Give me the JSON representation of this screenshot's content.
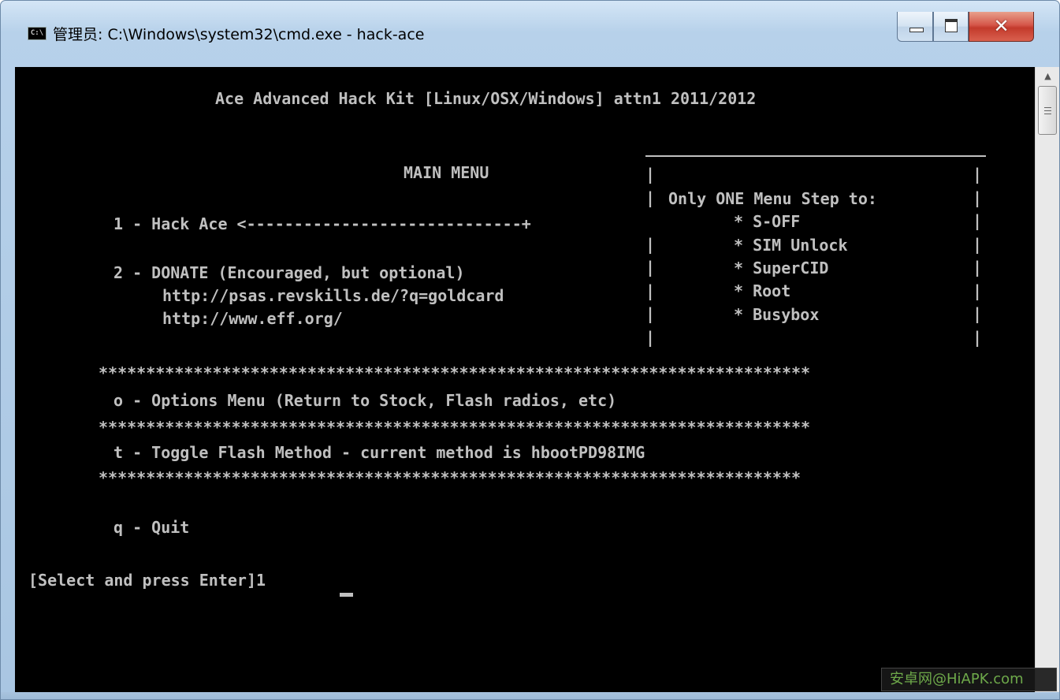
{
  "window": {
    "title": "管理员: C:\\Windows\\system32\\cmd.exe - hack-ace",
    "icon_label": "C:\\"
  },
  "console": {
    "lines": [
      "           Ace Advanced Hack Kit [Linux/OSX/Windows] attn1 2011/2012",
      "                                         ________________________________",
      "                        MAIN MENU        |                                |",
      "                                         | Only ONE Menu Step to:         |",
      "     1 - Hack Ace <----------------------+      * S-OFF                   |",
      "                                         |      * SIM Unlock              |",
      "     2 - DONATE (Encouraged, but optional) |    * SuperCID                |",
      "         http://psas.revskills.de/?q=goldcard |  * Root                   |",
      "         http://www.eff.org/             |      * Busybox                 |",
      "                                         |                                |",
      "***************************************************************************",
      "     o - Options Menu (Return to Stock, Flash radios, etc)",
      "***************************************************************************",
      "     t - Toggle Flash Method - current method is hbootPD98IMG",
      "**************************************************************************",
      "     q - Quit",
      "[Select and press Enter]1"
    ]
  },
  "watermark": "安卓网@HiAPK.com"
}
